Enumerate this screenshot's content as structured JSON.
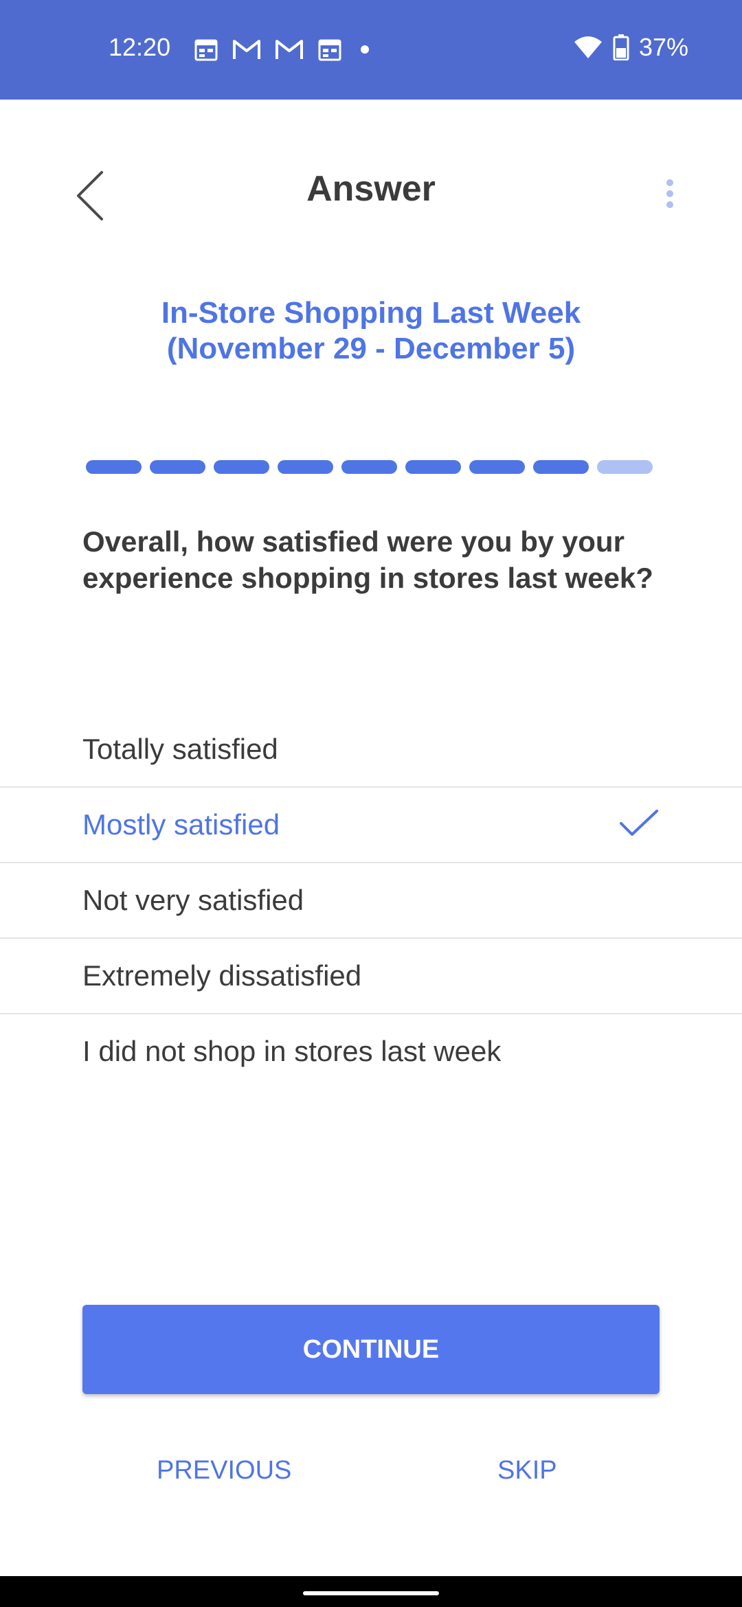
{
  "status_bar": {
    "time": "12:20",
    "battery": "37%",
    "icons": [
      "calendar-icon",
      "gmail-icon",
      "gmail-icon",
      "calendar-icon",
      "dot-icon",
      "wifi-icon",
      "battery-icon"
    ]
  },
  "header": {
    "title": "Answer"
  },
  "survey": {
    "title": "In-Store Shopping Last Week (November 29 - December 5)",
    "progress": {
      "completed": 8,
      "total": 9
    },
    "question": "Overall, how satisfied were you by your experience shopping in stores last week?",
    "options": [
      {
        "label": "Totally satisfied",
        "selected": false
      },
      {
        "label": "Mostly satisfied",
        "selected": true
      },
      {
        "label": "Not very satisfied",
        "selected": false
      },
      {
        "label": "Extremely dissatisfied",
        "selected": false
      },
      {
        "label": "I did not shop in stores last week",
        "selected": false
      }
    ]
  },
  "actions": {
    "continue": "CONTINUE",
    "previous": "PREVIOUS",
    "skip": "SKIP"
  },
  "colors": {
    "status_bar": "#4f6bcf",
    "accent": "#4f74e6",
    "button": "#5577ee",
    "text": "#3b3b3b"
  }
}
